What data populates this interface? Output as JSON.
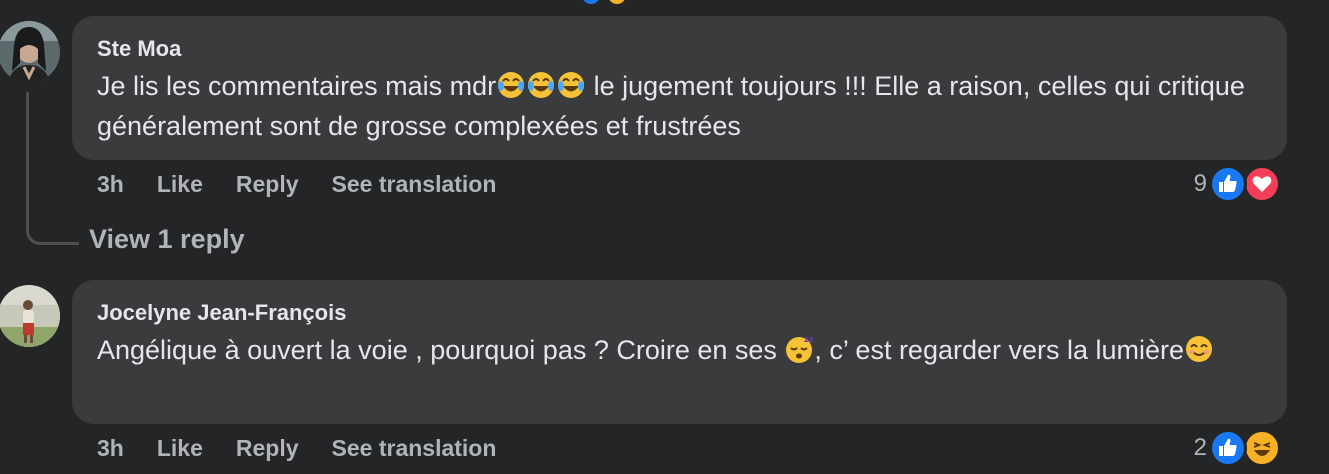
{
  "comments": [
    {
      "author": "Ste Moa",
      "text_part1": "Je lis les commentaires mais mdr",
      "text_part2": " le jugement toujours !!! Elle a raison, celles qui critique généralement sont de grosse complexées et frustrées",
      "emojis": [
        "face-with-tears-of-joy",
        "face-with-tears-of-joy",
        "face-with-tears-of-joy"
      ],
      "time": "3h",
      "like_label": "Like",
      "reply_label": "Reply",
      "translate_label": "See translation",
      "reaction_count": "9",
      "reaction_icons": [
        "like-icon",
        "love-icon"
      ],
      "view_replies": "View 1 reply"
    },
    {
      "author": "Jocelyne Jean-François",
      "text_part1": "Angélique à ouvert la voie , pourquoi pas ? Croire en ses ",
      "text_part2": ", c’ est regarder vers la lumière",
      "emojis": [
        "sleeping-face",
        "smiling-face-with-smiling-eyes"
      ],
      "time": "3h",
      "like_label": "Like",
      "reply_label": "Reply",
      "translate_label": "See translation",
      "reaction_count": "2",
      "reaction_icons": [
        "like-icon",
        "haha-icon"
      ]
    }
  ],
  "colors": {
    "background": "#242526",
    "bubble": "#3a3b3c",
    "text": "#e4e6eb",
    "secondary_text": "#b0b3b8",
    "like_blue": "#1877f2",
    "love_red": "#f33e58",
    "haha_yellow": "#f7b125"
  }
}
